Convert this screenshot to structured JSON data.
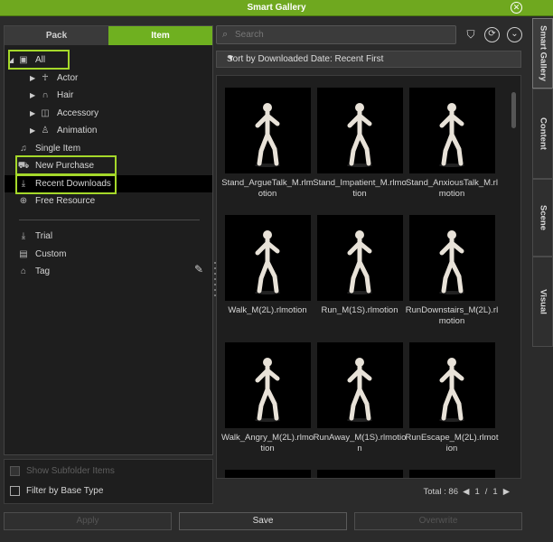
{
  "window": {
    "title": "Smart Gallery"
  },
  "left_panel": {
    "tabs": [
      "Pack",
      "Item"
    ],
    "active_tab": "Item",
    "tree": {
      "all": "All",
      "actor": "Actor",
      "hair": "Hair",
      "accessory": "Accessory",
      "animation": "Animation",
      "single_item": "Single Item",
      "new_purchase": "New Purchase",
      "recent_downloads": "Recent Downloads",
      "free_resource": "Free Resource",
      "trial": "Trial",
      "custom": "Custom",
      "tag": "Tag"
    },
    "options": {
      "show_subfolder_items": "Show Subfolder Items",
      "filter_by_base_type": "Filter by Base Type"
    }
  },
  "search": {
    "placeholder": "Search"
  },
  "sort": {
    "label": "Sort by Downloaded Date: Recent First"
  },
  "items": [
    "Stand_ArgueTalk_M.rlmotion",
    "Stand_Impatient_M.rlmotion",
    "Stand_AnxiousTalk_M.rlmotion",
    "Walk_M(2L).rlmotion",
    "Run_M(1S).rlmotion",
    "RunDownstairs_M(2L).rlmotion",
    "Walk_Angry_M(2L).rlmotion",
    "RunAway_M(1S).rlmotion",
    "RunEscape_M(2L).rlmotion"
  ],
  "footer": {
    "total_label": "Total : 86",
    "page_current": "1",
    "page_sep": "/",
    "page_total": "1"
  },
  "buttons": {
    "apply": "Apply",
    "save": "Save",
    "overwrite": "Overwrite"
  },
  "side_tabs": [
    "Smart Gallery",
    "Content",
    "Scene",
    "Visual"
  ],
  "colors": {
    "accent": "#6fb020",
    "highlight": "#a5d82a"
  }
}
